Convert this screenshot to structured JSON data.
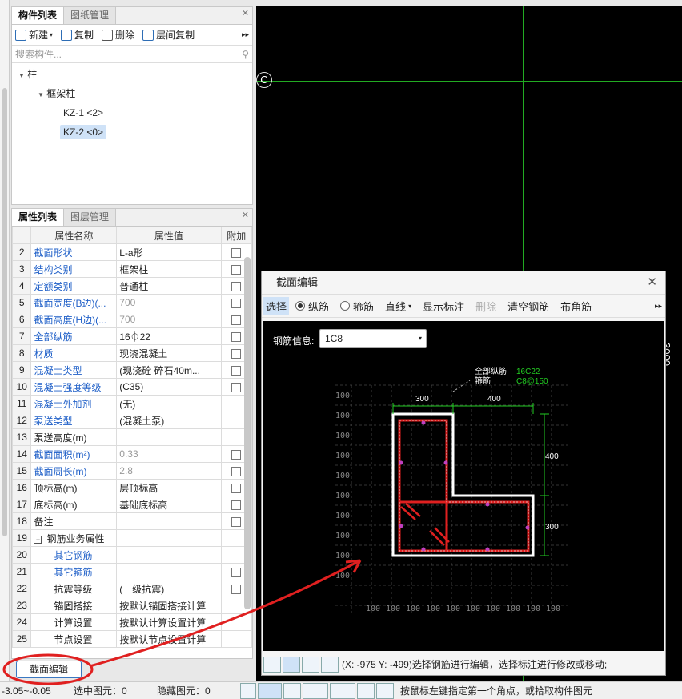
{
  "component_panel": {
    "tabs": [
      "构件列表",
      "图纸管理"
    ],
    "toolbar": {
      "new": "新建",
      "copy": "复制",
      "delete": "删除",
      "floor_copy": "层间复制"
    },
    "search_placeholder": "搜索构件...",
    "tree": {
      "root": "柱",
      "group": "框架柱",
      "items": [
        "KZ-1 <2>",
        "KZ-2 <0>"
      ]
    }
  },
  "property_panel": {
    "tabs": [
      "属性列表",
      "图层管理"
    ],
    "headers": [
      "属性名称",
      "属性值",
      "附加"
    ],
    "rows": [
      {
        "n": "2",
        "name": "截面形状",
        "value": "L-a形",
        "blue": true,
        "cb": true
      },
      {
        "n": "3",
        "name": "结构类别",
        "value": "框架柱",
        "blue": true,
        "cb": true
      },
      {
        "n": "4",
        "name": "定额类别",
        "value": "普通柱",
        "blue": true,
        "cb": true
      },
      {
        "n": "5",
        "name": "截面宽度(B边)(...",
        "value": "700",
        "blue": true,
        "cb": true,
        "gray": true
      },
      {
        "n": "6",
        "name": "截面高度(H边)(...",
        "value": "700",
        "blue": true,
        "cb": true,
        "gray": true
      },
      {
        "n": "7",
        "name": "全部纵筋",
        "value": "16⏀22",
        "blue": true,
        "cb": true
      },
      {
        "n": "8",
        "name": "材质",
        "value": "现浇混凝土",
        "blue": true,
        "cb": true
      },
      {
        "n": "9",
        "name": "混凝土类型",
        "value": "(现浇砼 碎石40m...",
        "blue": true,
        "cb": true
      },
      {
        "n": "10",
        "name": "混凝土强度等级",
        "value": "(C35)",
        "blue": true,
        "cb": true
      },
      {
        "n": "11",
        "name": "混凝土外加剂",
        "value": "(无)",
        "blue": true,
        "cb": false
      },
      {
        "n": "12",
        "name": "泵送类型",
        "value": "(混凝土泵)",
        "blue": true,
        "cb": false
      },
      {
        "n": "13",
        "name": "泵送高度(m)",
        "value": "",
        "blue": false,
        "cb": false
      },
      {
        "n": "14",
        "name": "截面面积(m²)",
        "value": "0.33",
        "blue": true,
        "cb": true,
        "gray": true
      },
      {
        "n": "15",
        "name": "截面周长(m)",
        "value": "2.8",
        "blue": true,
        "cb": true,
        "gray": true
      },
      {
        "n": "16",
        "name": "顶标高(m)",
        "value": "层顶标高",
        "blue": false,
        "cb": true
      },
      {
        "n": "17",
        "name": "底标高(m)",
        "value": "基础底标高",
        "blue": false,
        "cb": true
      },
      {
        "n": "18",
        "name": "备注",
        "value": "",
        "blue": false,
        "cb": true
      },
      {
        "n": "19",
        "name": "钢筋业务属性",
        "value": "",
        "blue": false,
        "cb": false,
        "group": true
      },
      {
        "n": "20",
        "name": "其它钢筋",
        "value": "",
        "blue": true,
        "cb": false,
        "indent": true
      },
      {
        "n": "21",
        "name": "其它箍筋",
        "value": "",
        "blue": true,
        "cb": true,
        "indent": true
      },
      {
        "n": "22",
        "name": "抗震等级",
        "value": "(一级抗震)",
        "blue": false,
        "cb": true,
        "indent": true
      },
      {
        "n": "23",
        "name": "锚固搭接",
        "value": "按默认锚固搭接计算",
        "blue": false,
        "cb": false,
        "indent": true
      },
      {
        "n": "24",
        "name": "计算设置",
        "value": "按默认计算设置计算",
        "blue": false,
        "cb": false,
        "indent": true
      },
      {
        "n": "25",
        "name": "节点设置",
        "value": "按默认节点设置计算",
        "blue": false,
        "cb": false,
        "indent": true
      }
    ],
    "section_edit_button": "截面编辑"
  },
  "statusbar": {
    "elevation": "-3.05~-0.05",
    "selected": "选中图元：0",
    "hidden": "隐藏图元：0",
    "hint": "按鼠标左键指定第一个角点，或拾取构件图元"
  },
  "viewport": {
    "axis_label": "C",
    "side_text": "3000"
  },
  "dialog": {
    "title": "截面编辑",
    "toolbar": {
      "select": "选择",
      "longitudinal": "纵筋",
      "stirrup": "箍筋",
      "line": "直线",
      "show_label": "显示标注",
      "delete": "删除",
      "clear": "清空钢筋",
      "corner": "布角筋"
    },
    "rebar_info_label": "钢筋信息:",
    "rebar_info_value": "1C8",
    "labels": {
      "all_long": "全部纵筋",
      "all_long_val": "16C22",
      "stirrup": "箍筋",
      "stirrup_val": "C8@150"
    },
    "dims": {
      "top1": "300",
      "top2": "400",
      "right1": "400",
      "right2": "300",
      "grid": "100"
    },
    "coords": "(X: -975 Y: -499)选择钢筋进行编辑，选择标注进行修改或移动;"
  },
  "colors": {
    "accent": "#2060c8",
    "rebar": "#e02020",
    "dim": "#22cc22",
    "annotate": "#e03030"
  }
}
